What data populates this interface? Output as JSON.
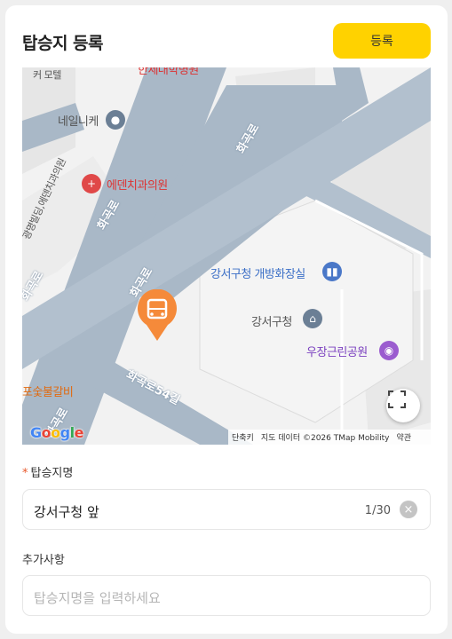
{
  "header": {
    "title": "탑승지 등록",
    "register_label": "등록"
  },
  "map": {
    "poi": {
      "nail": "네일니케",
      "dental": "에덴치과의원",
      "toilet": "강서구청 개방화장실",
      "office": "강서구청",
      "park": "우장근린공원",
      "restaurant": "포숯불갈비",
      "top_partial": "한세대학병원",
      "diag_building": "광명빌딩,에덴치과의원",
      "top_left_partial": "커 모텔"
    },
    "roads": {
      "main1": "화곡로",
      "main2": "화곡로",
      "main3": "화곡로",
      "side1": "화곡로54길",
      "side2": "화곡로",
      "side3": "화곡로"
    },
    "google": "Google",
    "attribution": {
      "shortcut": "단축키",
      "data": "지도 데이터 ©2026 TMap Mobility",
      "terms": "약관"
    }
  },
  "form": {
    "stop_name": {
      "label": "탑승지명",
      "required_mark": "*",
      "value": "강서구청 앞",
      "count": "1/30"
    },
    "extra": {
      "label": "추가사항",
      "placeholder": "탑승지명을 입력하세요"
    }
  },
  "colors": {
    "accent": "#ffd200",
    "marker": "#f58a3a",
    "road": "#a9b8c7"
  }
}
